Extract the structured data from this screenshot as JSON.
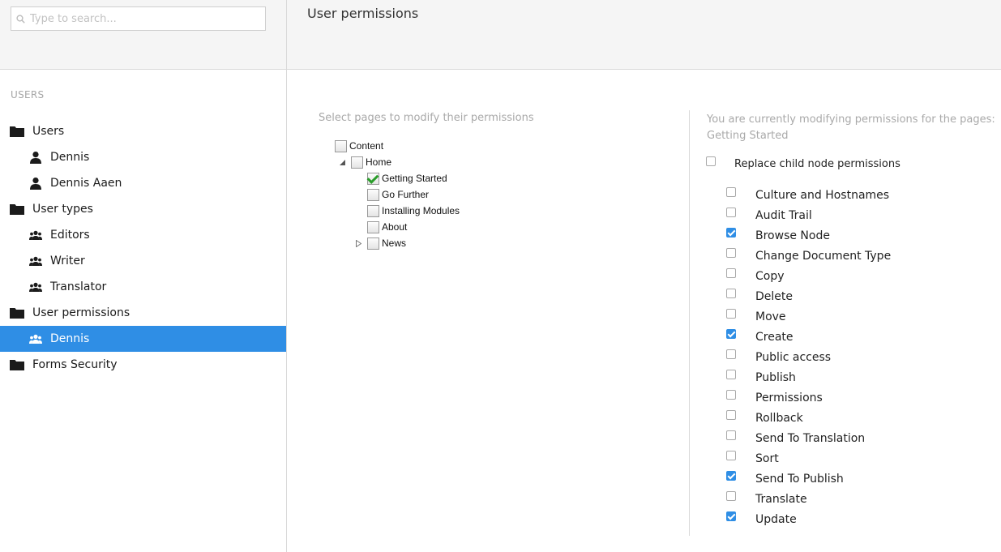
{
  "search": {
    "placeholder": "Type to search..."
  },
  "sidebar": {
    "section_title": "USERS",
    "items": [
      {
        "label": "Users",
        "icon": "folder-icon",
        "level": 0,
        "selected": false
      },
      {
        "label": "Dennis",
        "icon": "user-icon",
        "level": 1,
        "selected": false
      },
      {
        "label": "Dennis Aaen",
        "icon": "user-icon",
        "level": 1,
        "selected": false
      },
      {
        "label": "User types",
        "icon": "folder-icon",
        "level": 0,
        "selected": false
      },
      {
        "label": "Editors",
        "icon": "users-group-icon",
        "level": 1,
        "selected": false
      },
      {
        "label": "Writer",
        "icon": "users-group-icon",
        "level": 1,
        "selected": false
      },
      {
        "label": "Translator",
        "icon": "users-group-icon",
        "level": 1,
        "selected": false
      },
      {
        "label": "User permissions",
        "icon": "folder-icon",
        "level": 0,
        "selected": false
      },
      {
        "label": "Dennis",
        "icon": "users-group-icon",
        "level": 1,
        "selected": true
      },
      {
        "label": "Forms Security",
        "icon": "folder-icon",
        "level": 0,
        "selected": false
      }
    ]
  },
  "header": {
    "title": "User permissions"
  },
  "main": {
    "left_label": "Select pages to modify their permissions",
    "content_tree": [
      {
        "label": "Content",
        "depth": 0,
        "checked": false,
        "toggle": "none"
      },
      {
        "label": "Home",
        "depth": 1,
        "checked": false,
        "toggle": "expanded"
      },
      {
        "label": "Getting Started",
        "depth": 2,
        "checked": true,
        "toggle": "none"
      },
      {
        "label": "Go Further",
        "depth": 2,
        "checked": false,
        "toggle": "none"
      },
      {
        "label": "Installing Modules",
        "depth": 2,
        "checked": false,
        "toggle": "none"
      },
      {
        "label": "About",
        "depth": 2,
        "checked": false,
        "toggle": "none"
      },
      {
        "label": "News",
        "depth": 2,
        "checked": false,
        "toggle": "collapsed"
      }
    ],
    "right_info_line1": "You are currently modifying permissions for the pages:",
    "right_info_line2": "Getting Started",
    "replace_label": "Replace child node permissions",
    "replace_checked": false,
    "permissions": [
      {
        "label": "Culture and Hostnames",
        "checked": false
      },
      {
        "label": "Audit Trail",
        "checked": false
      },
      {
        "label": "Browse Node",
        "checked": true
      },
      {
        "label": "Change Document Type",
        "checked": false
      },
      {
        "label": "Copy",
        "checked": false
      },
      {
        "label": "Delete",
        "checked": false
      },
      {
        "label": "Move",
        "checked": false
      },
      {
        "label": "Create",
        "checked": true
      },
      {
        "label": "Public access",
        "checked": false
      },
      {
        "label": "Publish",
        "checked": false
      },
      {
        "label": "Permissions",
        "checked": false
      },
      {
        "label": "Rollback",
        "checked": false
      },
      {
        "label": "Send To Translation",
        "checked": false
      },
      {
        "label": "Sort",
        "checked": false
      },
      {
        "label": "Send To Publish",
        "checked": true
      },
      {
        "label": "Translate",
        "checked": false
      },
      {
        "label": "Update",
        "checked": true
      }
    ]
  },
  "colors": {
    "accent": "#2f8ee5",
    "check_green": "#2a9d2a",
    "muted_text": "#a9a9a9"
  }
}
